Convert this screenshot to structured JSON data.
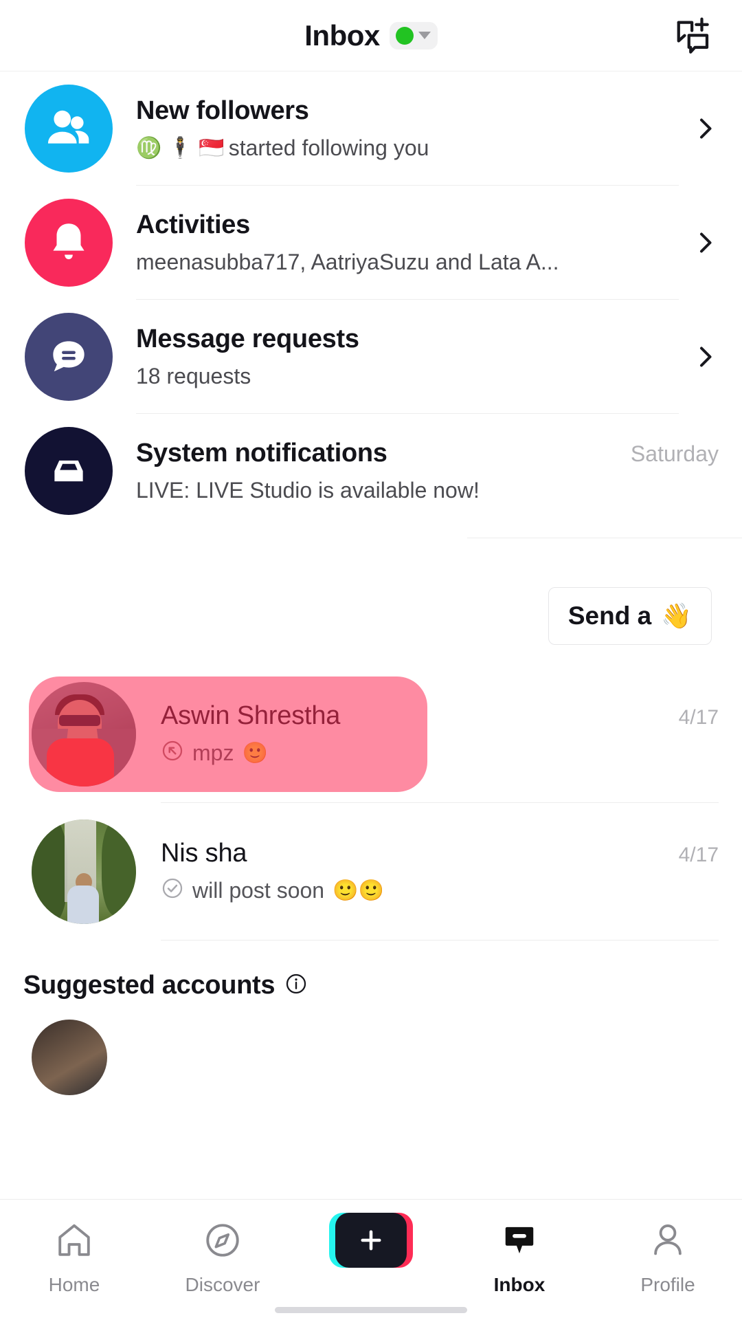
{
  "header": {
    "title": "Inbox",
    "status_dot_color": "#22c322",
    "compose_icon": "new-message-icon"
  },
  "notifications": [
    {
      "icon": "people-icon",
      "icon_color": "#11b4f0",
      "title": "New followers",
      "subtitle_emojis": "♍ 🕴️ 🇸🇬",
      "subtitle": "started following you",
      "time": "",
      "chevron": "chevron-right-icon"
    },
    {
      "icon": "bell-icon",
      "icon_color": "#f9295b",
      "title": "Activities",
      "subtitle_emojis": "",
      "subtitle": "meenasubba717, AatriyaSuzu and Lata A...",
      "time": "",
      "chevron": "chevron-right-icon"
    },
    {
      "icon": "message-bubble-icon",
      "icon_color": "#424577",
      "title": "Message requests",
      "subtitle_emojis": "",
      "subtitle": "18 requests",
      "time": "",
      "chevron": "chevron-right-icon"
    },
    {
      "icon": "inbox-tray-icon",
      "icon_color": "#121233",
      "title": "System notifications",
      "subtitle_emojis": "",
      "subtitle": "LIVE: LIVE Studio is available now!",
      "time": "Saturday",
      "chevron": ""
    }
  ],
  "wave_button": {
    "label": "Send a",
    "emoji": "👋"
  },
  "chats": [
    {
      "avatar": "aswin-avatar",
      "name": "Aswin Shrestha",
      "status_icon": "sent-arrow-icon",
      "preview": "mpz",
      "preview_emojis": "🙂",
      "date": "4/17",
      "selected": true
    },
    {
      "avatar": "nissha-avatar",
      "name": "Nis sha",
      "status_icon": "read-check-icon",
      "preview": "will post soon",
      "preview_emojis": "🙂🙂",
      "date": "4/17",
      "selected": false
    }
  ],
  "suggested": {
    "title": "Suggested accounts",
    "info_icon": "info-circle-icon"
  },
  "bottom_nav": {
    "items": [
      {
        "label": "Home",
        "icon": "home-icon",
        "active": false
      },
      {
        "label": "Discover",
        "icon": "compass-icon",
        "active": false
      },
      {
        "label": "",
        "icon": "create-plus-icon",
        "active": false
      },
      {
        "label": "Inbox",
        "icon": "inbox-bubble-icon",
        "active": true
      },
      {
        "label": "Profile",
        "icon": "person-icon",
        "active": false
      }
    ],
    "create_colors": {
      "cyan": "#25f4ee",
      "pink": "#fe2c55",
      "core": "#161823"
    }
  }
}
